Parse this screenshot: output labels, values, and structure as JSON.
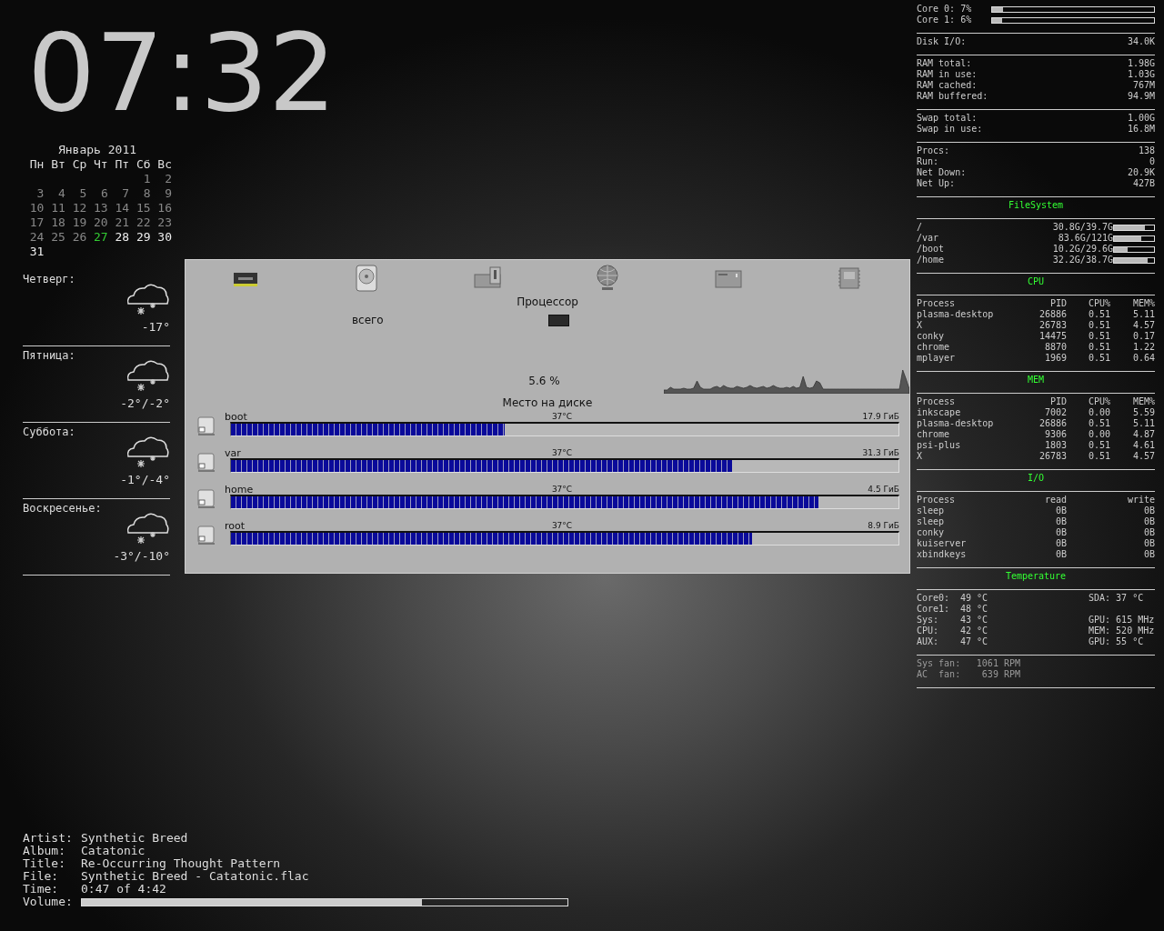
{
  "clock": {
    "time": "07:32"
  },
  "calendar": {
    "title": "Январь 2011",
    "weekdays": [
      "Пн",
      "Вт",
      "Ср",
      "Чт",
      "Пт",
      "Сб",
      "Вс"
    ],
    "weeks": [
      {
        "kind": "leading",
        "days": [
          {
            "day": "1",
            "kind": "past"
          },
          {
            "day": "2",
            "kind": "past"
          }
        ]
      },
      {
        "kind": "full",
        "days": [
          {
            "day": "3",
            "kind": "past"
          },
          {
            "day": "4",
            "kind": "past"
          },
          {
            "day": "5",
            "kind": "past"
          },
          {
            "day": "6",
            "kind": "past"
          },
          {
            "day": "7",
            "kind": "past"
          },
          {
            "day": "8",
            "kind": "past"
          },
          {
            "day": "9",
            "kind": "past"
          }
        ]
      },
      {
        "kind": "full",
        "days": [
          {
            "day": "10",
            "kind": "past"
          },
          {
            "day": "11",
            "kind": "past"
          },
          {
            "day": "12",
            "kind": "past"
          },
          {
            "day": "13",
            "kind": "past"
          },
          {
            "day": "14",
            "kind": "past"
          },
          {
            "day": "15",
            "kind": "past"
          },
          {
            "day": "16",
            "kind": "past"
          }
        ]
      },
      {
        "kind": "full",
        "days": [
          {
            "day": "17",
            "kind": "past"
          },
          {
            "day": "18",
            "kind": "past"
          },
          {
            "day": "19",
            "kind": "past"
          },
          {
            "day": "20",
            "kind": "past"
          },
          {
            "day": "21",
            "kind": "past"
          },
          {
            "day": "22",
            "kind": "past"
          },
          {
            "day": "23",
            "kind": "past"
          }
        ]
      },
      {
        "kind": "full",
        "days": [
          {
            "day": "24",
            "kind": "past"
          },
          {
            "day": "25",
            "kind": "past"
          },
          {
            "day": "26",
            "kind": "past"
          },
          {
            "day": "27",
            "kind": "today"
          },
          {
            "day": "28",
            "kind": "future"
          },
          {
            "day": "29",
            "kind": "future"
          },
          {
            "day": "30",
            "kind": "future"
          }
        ]
      },
      {
        "kind": "trailing",
        "days": [
          {
            "day": "31",
            "kind": "future"
          }
        ]
      }
    ]
  },
  "weather": [
    {
      "day": "Четверг:",
      "temp": "-17°"
    },
    {
      "day": "Пятница:",
      "temp": "-2°/-2°"
    },
    {
      "day": "Суббота:",
      "temp": "-1°/-4°"
    },
    {
      "day": "Воскресенье:",
      "temp": "-3°/-10°"
    }
  ],
  "monitor": {
    "title": "Процессор",
    "total_label": "всего",
    "cpu_reading": "5.6 %",
    "disk_title": "Место на диске",
    "disks": [
      {
        "name": "boot",
        "temp": "37°C",
        "size": "17.9 ГиБ",
        "level": 0.41
      },
      {
        "name": "var",
        "temp": "37°C",
        "size": "31.3 ГиБ",
        "level": 0.75
      },
      {
        "name": "home",
        "temp": "37°C",
        "size": "4.5 ГиБ",
        "level": 0.88
      },
      {
        "name": "root",
        "temp": "37°C",
        "size": "8.9 ГиБ",
        "level": 0.78
      }
    ]
  },
  "music": {
    "rows": [
      {
        "label": "Artist:",
        "value": "Synthetic Breed"
      },
      {
        "label": "Album:",
        "value": "Catatonic"
      },
      {
        "label": "Title:",
        "value": "Re-Occurring Thought Pattern"
      },
      {
        "label": "File:",
        "value": "Synthetic Breed - Catatonic.flac"
      },
      {
        "label": "Time:",
        "value": "0:47 of 4:42"
      }
    ],
    "volume": {
      "label": "Volume:",
      "level": 0.7
    }
  },
  "system": {
    "cores": [
      {
        "label": "Core 0: 7%",
        "level": 0.07
      },
      {
        "label": "Core 1: 6%",
        "level": 0.06
      }
    ],
    "groups": [
      [
        {
          "label": "Disk I/O:",
          "value": "34.0K"
        }
      ],
      [
        {
          "label": "RAM total:",
          "value": "1.98G"
        },
        {
          "label": "RAM in use:",
          "value": "1.03G"
        },
        {
          "label": "RAM cached:",
          "value": "767M"
        },
        {
          "label": "RAM buffered:",
          "value": "94.9M"
        }
      ],
      [
        {
          "label": "Swap total:",
          "value": "1.00G"
        },
        {
          "label": "Swap in use:",
          "value": "16.8M"
        }
      ],
      [
        {
          "label": "Procs:",
          "value": "138"
        },
        {
          "label": "Run:",
          "value": "0"
        },
        {
          "label": "Net Down:",
          "value": "20.9K"
        },
        {
          "label": "Net Up:",
          "value": "427B"
        }
      ]
    ],
    "filesystem": {
      "title": "FileSystem",
      "rows": [
        {
          "mount": "/",
          "usage": "30.8G/39.7G",
          "level": 0.78
        },
        {
          "mount": "/var",
          "usage": "83.6G/121G",
          "level": 0.69
        },
        {
          "mount": "/boot",
          "usage": "10.2G/29.6G",
          "level": 0.34
        },
        {
          "mount": "/home",
          "usage": "32.2G/38.7G",
          "level": 0.83
        }
      ]
    },
    "tables": [
      {
        "title": "CPU",
        "columns": [
          "Process",
          "PID",
          "CPU%",
          "MEM%"
        ],
        "rows": [
          [
            "plasma-desktop",
            "26886",
            "0.51",
            "5.11"
          ],
          [
            "X",
            "26783",
            "0.51",
            "4.57"
          ],
          [
            "conky",
            "14475",
            "0.51",
            "0.17"
          ],
          [
            "chrome",
            "8870",
            "0.51",
            "1.22"
          ],
          [
            "mplayer",
            "1969",
            "0.51",
            "0.64"
          ]
        ]
      },
      {
        "title": "MEM",
        "columns": [
          "Process",
          "PID",
          "CPU%",
          "MEM%"
        ],
        "rows": [
          [
            "inkscape",
            "7002",
            "0.00",
            "5.59"
          ],
          [
            "plasma-desktop",
            "26886",
            "0.51",
            "5.11"
          ],
          [
            "chrome",
            "9306",
            "0.00",
            "4.87"
          ],
          [
            "psi-plus",
            "1803",
            "0.51",
            "4.61"
          ],
          [
            "X",
            "26783",
            "0.51",
            "4.57"
          ]
        ]
      },
      {
        "title": "I/O",
        "columns": [
          "Process",
          "read",
          "write"
        ],
        "rows": [
          [
            "sleep",
            "0B",
            "0B"
          ],
          [
            "sleep",
            "0B",
            "0B"
          ],
          [
            "conky",
            "0B",
            "0B"
          ],
          [
            "kuiserver",
            "0B",
            "0B"
          ],
          [
            "xbindkeys",
            "0B",
            "0B"
          ]
        ]
      }
    ],
    "temperature": {
      "title": "Temperature",
      "rows": [
        {
          "label": "Core0:",
          "value": "49 °C",
          "extra": "SDA: 37 °C"
        },
        {
          "label": "Core1:",
          "value": "48 °C"
        },
        {
          "label": "Sys:",
          "value": "43 °C",
          "extra": "GPU: 615 MHz"
        },
        {
          "label": "CPU:",
          "value": "42 °C",
          "extra": "MEM: 520 MHz"
        },
        {
          "label": "AUX:",
          "value": "47 °C",
          "extra": "GPU: 55 °C"
        }
      ]
    },
    "fans": [
      {
        "label": "Sys fan:",
        "value": "1061 RPM"
      },
      {
        "label": "AC  fan:",
        "value": "639 RPM"
      }
    ]
  }
}
